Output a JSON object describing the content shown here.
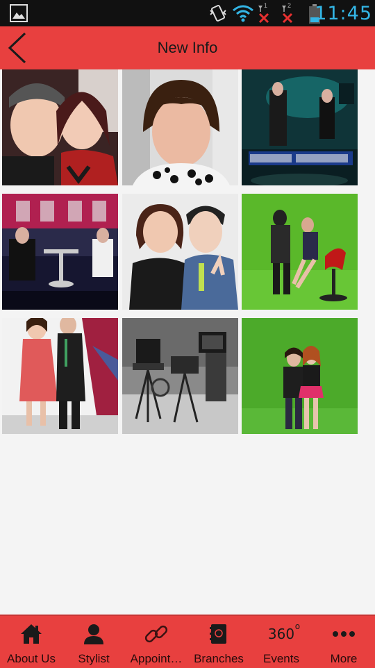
{
  "status_bar": {
    "time": "11:45",
    "sim1": "1",
    "sim2": "2",
    "icons": [
      "gallery-notification-icon",
      "vibrate-icon",
      "wifi-icon",
      "signal-sim1-icon",
      "signal-sim2-icon",
      "battery-icon"
    ]
  },
  "header": {
    "title": "New Info",
    "back_icon": "chevron-left-icon",
    "color": "#e8403f"
  },
  "gallery": {
    "photos": [
      {
        "name": "photo-selfie-couple",
        "palette": [
          "#4a2a2a",
          "#f0c8b0",
          "#b02020"
        ]
      },
      {
        "name": "photo-short-hair-selfie",
        "palette": [
          "#dadada",
          "#e8b8a0",
          "#222222"
        ]
      },
      {
        "name": "photo-tv-studio-news",
        "palette": [
          "#0a2a2a",
          "#1a8a8a",
          "#222222"
        ]
      },
      {
        "name": "photo-news-set-hosts",
        "palette": [
          "#1a1a3a",
          "#c8284a",
          "#e0e0e0"
        ]
      },
      {
        "name": "photo-duo-selfie",
        "palette": [
          "#e8e8e8",
          "#1a1a1a",
          "#4a6a9a"
        ]
      },
      {
        "name": "photo-green-screen-makeup",
        "palette": [
          "#5ab82a",
          "#222222",
          "#c01818"
        ]
      },
      {
        "name": "photo-pink-dress-duo",
        "palette": [
          "#f0f0f0",
          "#e05050",
          "#222222"
        ]
      },
      {
        "name": "photo-studio-cameras",
        "palette": [
          "#9a9a9a",
          "#2a2a2a",
          "#6a6a6a"
        ]
      },
      {
        "name": "photo-green-screen-duo",
        "palette": [
          "#4aa82a",
          "#222222",
          "#e0306a"
        ]
      }
    ]
  },
  "bottom_nav": {
    "items": [
      {
        "label": "About Us",
        "icon": "home-icon"
      },
      {
        "label": "Stylist",
        "icon": "person-icon"
      },
      {
        "label": "Appoint…",
        "icon": "link-icon"
      },
      {
        "label": "Branches",
        "icon": "branches-icon"
      },
      {
        "label": "Events",
        "icon": "360-icon",
        "icon_text": "360"
      },
      {
        "label": "More",
        "icon": "more-dots-icon"
      }
    ]
  }
}
